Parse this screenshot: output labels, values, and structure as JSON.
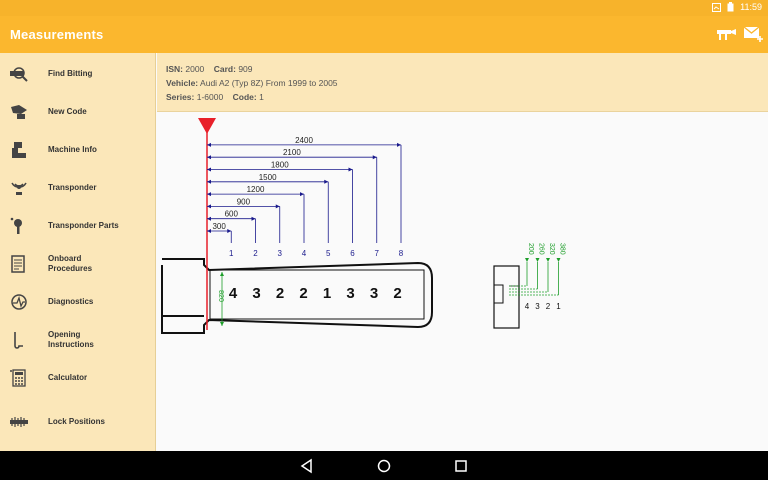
{
  "status": {
    "time": "11:59"
  },
  "appbar": {
    "title": "Measurements",
    "actions": [
      {
        "icon": "key-machine-icon"
      },
      {
        "icon": "mail-add-icon"
      }
    ]
  },
  "sidebar": {
    "items": [
      {
        "label": "Find Bitting",
        "icon": "find-bitting-icon"
      },
      {
        "label": "New Code",
        "icon": "new-code-icon"
      },
      {
        "label": "Machine Info",
        "icon": "machine-icon"
      },
      {
        "label": "Transponder",
        "icon": "transponder-icon"
      },
      {
        "label": "Transponder Parts",
        "icon": "transponder-parts-icon"
      },
      {
        "label": "Onboard Procedures",
        "line1": "Onboard",
        "line2": "Procedures",
        "icon": "onboard-procedures-icon"
      },
      {
        "label": "Diagnostics",
        "icon": "diagnostics-icon"
      },
      {
        "label": "Opening Instructions",
        "line1": "Opening",
        "line2": "Instructions",
        "icon": "opening-instructions-icon"
      },
      {
        "label": "Calculator",
        "icon": "calculator-icon"
      },
      {
        "label": "Lock Positions",
        "icon": "lock-positions-icon"
      }
    ]
  },
  "info": {
    "isn_label": "ISN:",
    "isn_value": "2000",
    "card_label": "Card:",
    "card_value": "909",
    "vehicle_label": "Vehicle:",
    "vehicle_value": "Audi A2 (Typ 8Z) From 1999 to 2005",
    "series_label": "Series:",
    "series_value": "1-6000",
    "code_label": "Code:",
    "code_value": "1"
  },
  "key": {
    "cut_positions": [
      {
        "number": "1",
        "distance": "300"
      },
      {
        "number": "2",
        "distance": "600"
      },
      {
        "number": "3",
        "distance": "900"
      },
      {
        "number": "4",
        "distance": "1200"
      },
      {
        "number": "5",
        "distance": "1500"
      },
      {
        "number": "6",
        "distance": "1800"
      },
      {
        "number": "7",
        "distance": "2100"
      },
      {
        "number": "8",
        "distance": "2400"
      }
    ],
    "bitting": [
      "4",
      "3",
      "2",
      "2",
      "1",
      "3",
      "3",
      "2"
    ],
    "blade_height": "820",
    "depths": [
      {
        "cut": "4",
        "value": "200"
      },
      {
        "cut": "3",
        "value": "260"
      },
      {
        "cut": "2",
        "value": "320"
      },
      {
        "cut": "1",
        "value": "380"
      }
    ]
  },
  "colors": {
    "accent": "#fbb72e",
    "dimension": "#1a1a8c",
    "stop": "#e8202a",
    "depth": "#1e9e2a"
  }
}
